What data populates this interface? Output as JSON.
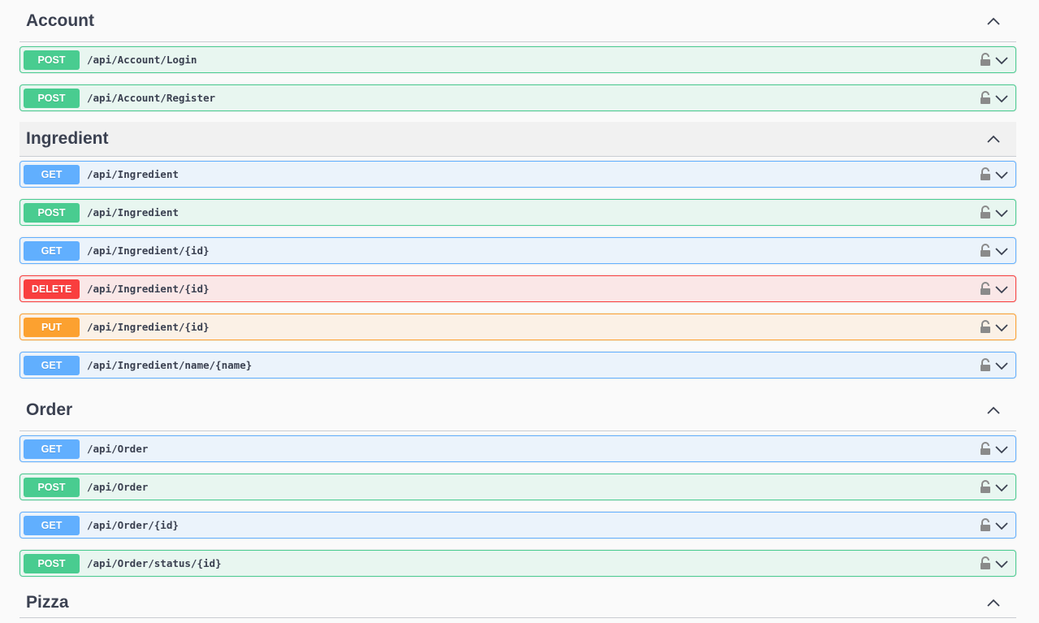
{
  "sections": [
    {
      "title": "Account",
      "highlight": false,
      "ops": [
        {
          "method": "POST",
          "path": "/api/Account/Login"
        },
        {
          "method": "POST",
          "path": "/api/Account/Register"
        }
      ]
    },
    {
      "title": "Ingredient",
      "highlight": true,
      "ops": [
        {
          "method": "GET",
          "path": "/api/Ingredient"
        },
        {
          "method": "POST",
          "path": "/api/Ingredient"
        },
        {
          "method": "GET",
          "path": "/api/Ingredient/{id}"
        },
        {
          "method": "DELETE",
          "path": "/api/Ingredient/{id}"
        },
        {
          "method": "PUT",
          "path": "/api/Ingredient/{id}"
        },
        {
          "method": "GET",
          "path": "/api/Ingredient/name/{name}"
        }
      ]
    },
    {
      "title": "Order",
      "highlight": false,
      "ops": [
        {
          "method": "GET",
          "path": "/api/Order"
        },
        {
          "method": "POST",
          "path": "/api/Order"
        },
        {
          "method": "GET",
          "path": "/api/Order/{id}"
        },
        {
          "method": "POST",
          "path": "/api/Order/status/{id}"
        }
      ]
    },
    {
      "title": "Pizza",
      "highlight": false,
      "ops": []
    }
  ],
  "icons": {
    "section_toggle": "chevron-up-icon",
    "op_lock": "lock-icon",
    "op_expand": "chevron-down-icon"
  },
  "colors": {
    "post": "#49cc90",
    "get": "#61affe",
    "delete": "#f93e3e",
    "put": "#fca130"
  }
}
